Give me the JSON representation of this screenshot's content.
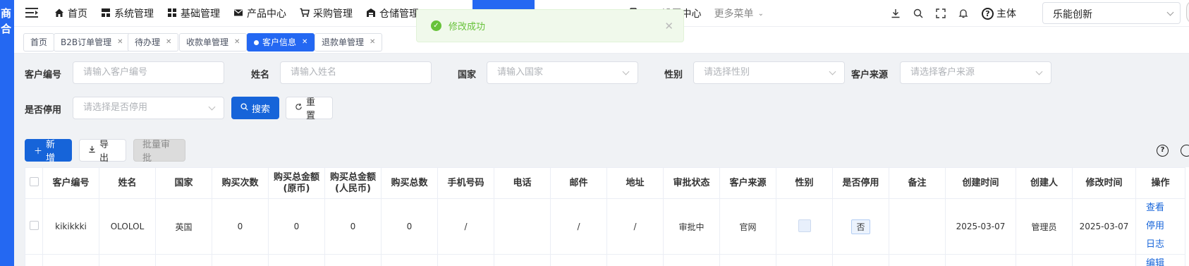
{
  "sidebar": {
    "logo_text": [
      "商",
      "合"
    ]
  },
  "topnav": {
    "menu": [
      {
        "icon": "home-icon",
        "label": "首页"
      },
      {
        "icon": "grid-icon",
        "label": "系统管理"
      },
      {
        "icon": "apps-icon",
        "label": "基础管理"
      },
      {
        "icon": "envelope-icon",
        "label": "产品中心"
      },
      {
        "icon": "cart-icon",
        "label": "采购管理"
      },
      {
        "icon": "warehouse-icon",
        "label": "仓储管理"
      }
    ],
    "menu_right": [
      {
        "icon": "device-icon",
        "label": "PDA设置中心"
      }
    ],
    "more_label": "更多菜单",
    "entity_label": "主体",
    "company_select": "乐能创新"
  },
  "tabs": [
    {
      "label": "首页",
      "closable": false,
      "active": false
    },
    {
      "label": "B2B订单管理",
      "closable": true,
      "active": false
    },
    {
      "label": "待办理",
      "closable": true,
      "active": false
    },
    {
      "label": "收款单管理",
      "closable": true,
      "active": false
    },
    {
      "label": "客户信息",
      "closable": true,
      "active": true
    },
    {
      "label": "退款单管理",
      "closable": true,
      "active": false
    }
  ],
  "toast": {
    "message": "修改成功",
    "type": "success"
  },
  "filters": {
    "customer_no": {
      "label": "客户编号",
      "placeholder": "请输入客户编号"
    },
    "name": {
      "label": "姓名",
      "placeholder": "请输入姓名"
    },
    "country": {
      "label": "国家",
      "placeholder": "请输入国家"
    },
    "gender": {
      "label": "性别",
      "placeholder": "请选择性别"
    },
    "source": {
      "label": "客户来源",
      "placeholder": "请选择客户来源"
    },
    "disabled": {
      "label": "是否停用",
      "placeholder": "请选择是否停用"
    },
    "search_label": "搜索",
    "reset_label": "重置"
  },
  "toolbar": {
    "add_label": "新增",
    "export_label": "导出",
    "batch_approve_label": "批量审批"
  },
  "table": {
    "columns": [
      "",
      "客户编号",
      "姓名",
      "国家",
      "购买次数",
      "购买总金额\n(原币)",
      "购买总金额\n(人民币)",
      "购买总数",
      "手机号码",
      "电话",
      "邮件",
      "地址",
      "审批状态",
      "客户来源",
      "性别",
      "是否停用",
      "备注",
      "创建时间",
      "创建人",
      "修改时间",
      "操作"
    ],
    "rows": [
      {
        "customer_no": "kikikkki",
        "name": "OLOLOL",
        "country": "英国",
        "purchase_count": "0",
        "total_amount_orig": "0",
        "total_amount_rmb": "0",
        "total_qty": "0",
        "mobile": "/",
        "phone": "",
        "email": "/",
        "address": "/",
        "approval_status": "审批中",
        "source": "官网",
        "gender": "",
        "disabled": "否",
        "remark": "",
        "created_at": "2025-03-07",
        "creator": "管理员",
        "updated_at": "2025-03-07",
        "actions": [
          "查看",
          "停用",
          "日志"
        ]
      }
    ],
    "next_row_action": "编辑"
  }
}
